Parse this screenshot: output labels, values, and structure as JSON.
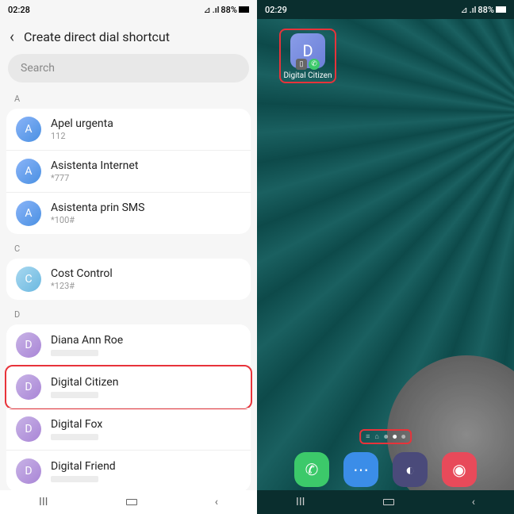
{
  "left": {
    "time": "02:28",
    "battery": "88%",
    "title": "Create direct dial shortcut",
    "searchPlaceholder": "Search",
    "sections": [
      {
        "letter": "A",
        "items": [
          {
            "name": "Apel urgenta",
            "sub": "112",
            "av": "A",
            "cls": "avA"
          },
          {
            "name": "Asistenta Internet",
            "sub": "*777",
            "av": "A",
            "cls": "avA"
          },
          {
            "name": "Asistenta prin SMS",
            "sub": "*100#",
            "av": "A",
            "cls": "avA"
          }
        ]
      },
      {
        "letter": "C",
        "items": [
          {
            "name": "Cost Control",
            "sub": "*123#",
            "av": "C",
            "cls": "avC"
          }
        ]
      },
      {
        "letter": "D",
        "items": [
          {
            "name": "Diana Ann Roe",
            "sub": "",
            "av": "D",
            "cls": "avD"
          },
          {
            "name": "Digital Citizen",
            "sub": "",
            "av": "D",
            "cls": "avD",
            "hl": true
          },
          {
            "name": "Digital Fox",
            "sub": "",
            "av": "D",
            "cls": "avD"
          },
          {
            "name": "Digital Friend",
            "sub": "",
            "av": "D",
            "cls": "avD"
          }
        ]
      }
    ]
  },
  "right": {
    "time": "02:29",
    "battery": "88%",
    "shortcut": {
      "letter": "D",
      "label": "Digital Citizen"
    }
  }
}
